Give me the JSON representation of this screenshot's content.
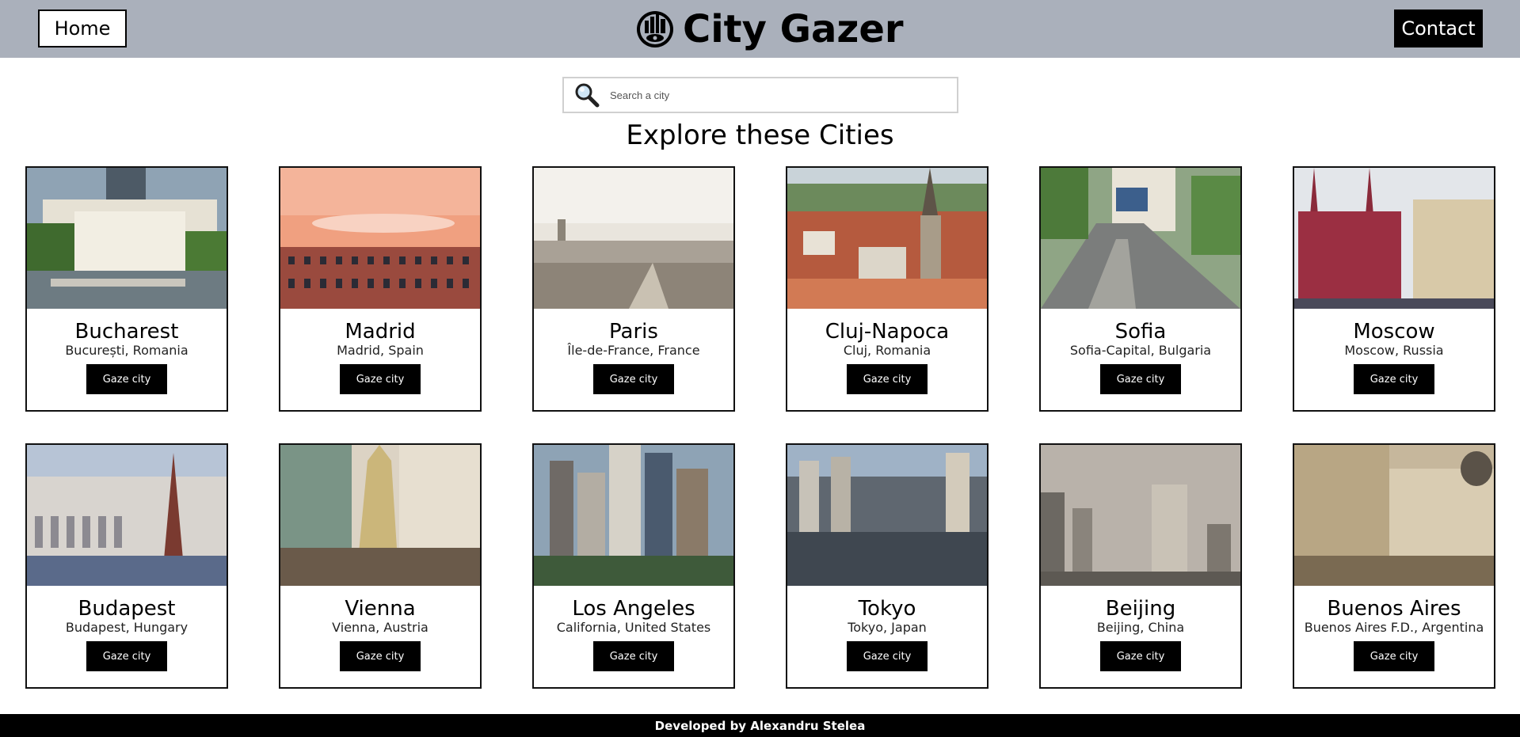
{
  "header": {
    "home_label": "Home",
    "brand_title": "City Gazer",
    "contact_label": "Contact"
  },
  "search": {
    "placeholder": "Search a city"
  },
  "heading": "Explore these Cities",
  "cities": [
    {
      "name": "Bucharest",
      "location": "București, Romania",
      "button": "Gaze city"
    },
    {
      "name": "Madrid",
      "location": "Madrid, Spain",
      "button": "Gaze city"
    },
    {
      "name": "Paris",
      "location": "Île-de-France, France",
      "button": "Gaze city"
    },
    {
      "name": "Cluj-Napoca",
      "location": "Cluj, Romania",
      "button": "Gaze city"
    },
    {
      "name": "Sofia",
      "location": "Sofia-Capital, Bulgaria",
      "button": "Gaze city"
    },
    {
      "name": "Moscow",
      "location": "Moscow, Russia",
      "button": "Gaze city"
    },
    {
      "name": "Budapest",
      "location": "Budapest, Hungary",
      "button": "Gaze city"
    },
    {
      "name": "Vienna",
      "location": "Vienna, Austria",
      "button": "Gaze city"
    },
    {
      "name": "Los Angeles",
      "location": "California, United States",
      "button": "Gaze city"
    },
    {
      "name": "Tokyo",
      "location": "Tokyo, Japan",
      "button": "Gaze city"
    },
    {
      "name": "Beijing",
      "location": "Beijing, China",
      "button": "Gaze city"
    },
    {
      "name": "Buenos Aires",
      "location": "Buenos Aires F.D., Argentina",
      "button": "Gaze city"
    }
  ],
  "footer": {
    "text": "Developed by Alexandru Stelea"
  },
  "colors": {
    "header_bg": "#aab0bb",
    "button_bg": "#000000",
    "footer_bg": "#000000"
  }
}
